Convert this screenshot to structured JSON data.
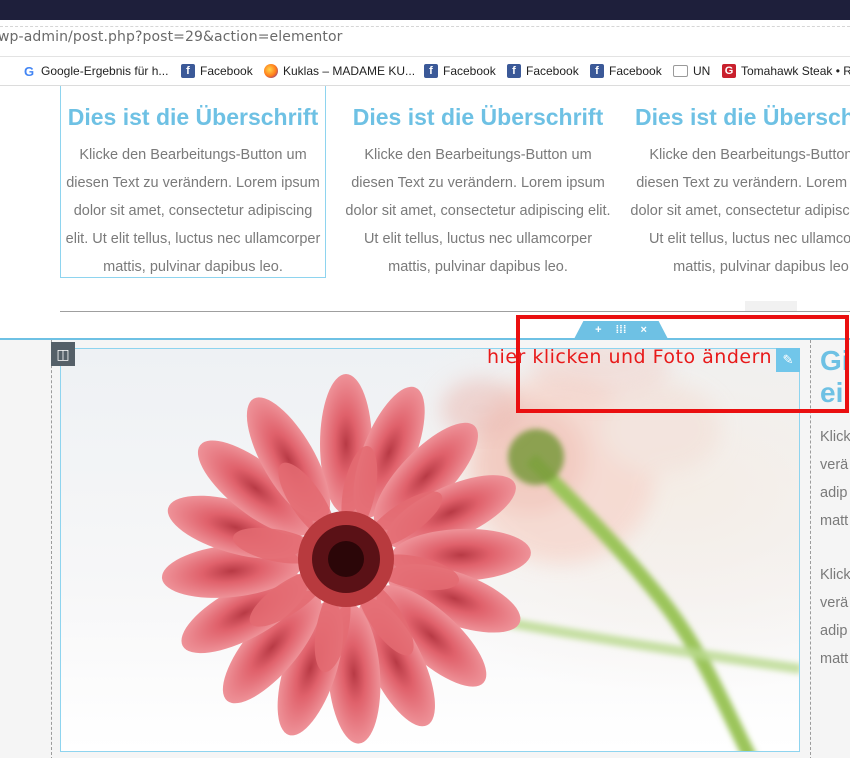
{
  "browser": {
    "url": "wp-admin/post.php?post=29&action=elementor",
    "bookmarks": [
      {
        "icon": "google-icon",
        "label": "Google-Ergebnis für h..."
      },
      {
        "icon": "facebook-icon",
        "label": "Facebook"
      },
      {
        "icon": "firefox-icon",
        "label": "Kuklas – MADAME KU..."
      },
      {
        "icon": "facebook-icon",
        "label": "Facebook"
      },
      {
        "icon": "facebook-icon",
        "label": "Facebook"
      },
      {
        "icon": "facebook-icon",
        "label": "Facebook"
      },
      {
        "icon": "folder-icon",
        "label": "UN"
      },
      {
        "icon": "tomahawk-icon",
        "label": "Tomahawk Steak • R"
      }
    ]
  },
  "editor": {
    "columns": [
      {
        "heading": "Dies ist die Überschrift",
        "text": "Klicke den Bearbeitungs-Button um diesen Text zu verändern. Lorem ipsum dolor sit amet, consectetur adipiscing elit. Ut elit tellus, luctus nec ullamcorper mattis, pulvinar dapibus leo."
      },
      {
        "heading": "Dies ist die Überschrift",
        "text": "Klicke den Bearbeitungs-Button um diesen Text zu verändern. Lorem ipsum dolor sit amet, consectetur adipiscing elit. Ut elit tellus, luctus nec ullamcorper mattis, pulvinar dapibus leo."
      },
      {
        "heading": "Dies ist die Übersch",
        "text": "Klicke den Bearbeitungs-Button um diesen Text zu verändern. Lorem ipsum dolor sit amet, consectetur adipiscing elit. Ut elit tellus, luctus nec ullamcorper mattis, pulvinar dapibus leo."
      }
    ],
    "section_controls": {
      "add": "+",
      "move": "⁞⁞⁞",
      "close": "×"
    },
    "annotation": "hier klicken und Foto ändern",
    "right_column": {
      "heading_line1": "Gi",
      "heading_line2": "ei",
      "para1": [
        "Klick",
        "verä",
        "adip",
        "matt"
      ],
      "para2": [
        "Klick",
        "verä",
        "adip",
        "matt"
      ]
    },
    "accent_color": "#6ec1e4",
    "annotation_color": "#e81a1a"
  }
}
